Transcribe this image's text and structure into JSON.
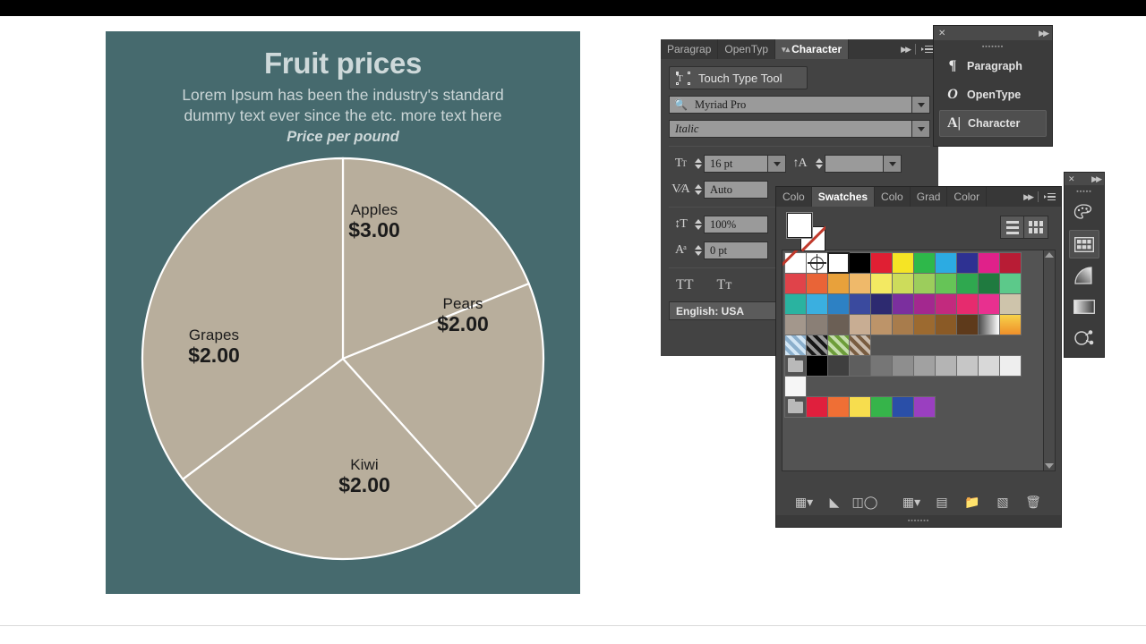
{
  "poster": {
    "title": "Fruit prices",
    "subtitle_line1": "Lorem Ipsum has been the industry's standard",
    "subtitle_line2": "dummy text ever since the etc. more text here",
    "note": "Price per pound",
    "background_color": "#466a6e",
    "slice_color": "#b8ae9c",
    "divider_color": "#ffffff"
  },
  "chart_data": {
    "type": "pie",
    "title": "Fruit prices",
    "subtitle": "Lorem Ipsum has been the industry's standard dummy text ever since the etc. more text here",
    "annotation": "Price per pound",
    "categories": [
      "Apples",
      "Pears",
      "Kiwi",
      "Grapes"
    ],
    "values": [
      3.0,
      2.0,
      2.0,
      2.0
    ],
    "value_labels": [
      "$3.00",
      "$2.00",
      "$2.00",
      "$2.00"
    ],
    "unit": "USD per pound",
    "slice_fill": "#b8ae9c",
    "legend": "none",
    "labels_inside": true,
    "slices": [
      {
        "name": "Apples",
        "value_label": "$3.00",
        "start_deg": 0,
        "end_deg": 68
      },
      {
        "name": "Pears",
        "value_label": "$2.00",
        "start_deg": 68,
        "end_deg": 138
      },
      {
        "name": "Kiwi",
        "value_label": "$2.00",
        "start_deg": 138,
        "end_deg": 233
      },
      {
        "name": "Grapes",
        "value_label": "$2.00",
        "start_deg": 233,
        "end_deg": 360
      }
    ]
  },
  "character_panel": {
    "tabs": [
      {
        "label": "Paragrap",
        "active": false
      },
      {
        "label": "OpenTyp",
        "active": false
      },
      {
        "label": "Character",
        "active": true
      }
    ],
    "touch_type_tool": "Touch Type Tool",
    "font_family": "Myriad Pro",
    "font_style": "Italic",
    "font_size": "16 pt",
    "leading": "",
    "kerning": "Auto",
    "vertical_scale": "100%",
    "baseline_shift": "0 pt",
    "all_caps": "TT",
    "small_caps": "Tт",
    "language": "English: USA"
  },
  "mini_dock": {
    "items": [
      {
        "icon": "¶",
        "label": "Paragraph",
        "selected": false
      },
      {
        "icon": "O",
        "label": "OpenType",
        "selected": false
      },
      {
        "icon": "A|",
        "label": "Character",
        "selected": true
      }
    ]
  },
  "swatches_panel": {
    "tabs": [
      {
        "label": "Colo",
        "active": false
      },
      {
        "label": "Swatches",
        "active": true
      },
      {
        "label": "Colo",
        "active": false
      },
      {
        "label": "Grad",
        "active": false
      },
      {
        "label": "Color",
        "active": false
      }
    ],
    "fill_color": "#ffffff",
    "stroke_color": "none",
    "rows": [
      {
        "kind": "colors",
        "cells": [
          {
            "type": "none"
          },
          {
            "type": "registration"
          },
          {
            "type": "color",
            "hex": "#ffffff",
            "selected": true
          },
          {
            "type": "color",
            "hex": "#000000"
          },
          {
            "type": "color",
            "hex": "#e01f33"
          },
          {
            "type": "color",
            "hex": "#f5e425"
          },
          {
            "type": "color",
            "hex": "#2eb84a"
          },
          {
            "type": "color",
            "hex": "#2cabe2"
          },
          {
            "type": "color",
            "hex": "#2e3192"
          },
          {
            "type": "color",
            "hex": "#e0218a"
          },
          {
            "type": "color",
            "hex": "#b81c35"
          }
        ]
      },
      {
        "kind": "colors",
        "cells": [
          {
            "type": "color",
            "hex": "#e0434a"
          },
          {
            "type": "color",
            "hex": "#e96437"
          },
          {
            "type": "color",
            "hex": "#e8a13b"
          },
          {
            "type": "color",
            "hex": "#efb96a"
          },
          {
            "type": "color",
            "hex": "#f3e962"
          },
          {
            "type": "color",
            "hex": "#cddc5b"
          },
          {
            "type": "color",
            "hex": "#9ccd5c"
          },
          {
            "type": "color",
            "hex": "#66c457"
          },
          {
            "type": "color",
            "hex": "#2fa84f"
          },
          {
            "type": "color",
            "hex": "#1f7a3f"
          },
          {
            "type": "color",
            "hex": "#5cc98a"
          }
        ]
      },
      {
        "kind": "colors",
        "cells": [
          {
            "type": "color",
            "hex": "#2ab3a0"
          },
          {
            "type": "color",
            "hex": "#3aafe0"
          },
          {
            "type": "color",
            "hex": "#2d81c4"
          },
          {
            "type": "color",
            "hex": "#3a4a9e"
          },
          {
            "type": "color",
            "hex": "#2d2a70"
          },
          {
            "type": "color",
            "hex": "#7b2f9e"
          },
          {
            "type": "color",
            "hex": "#a3288f"
          },
          {
            "type": "color",
            "hex": "#c22a7e"
          },
          {
            "type": "color",
            "hex": "#e62b6e"
          },
          {
            "type": "color",
            "hex": "#e8308f"
          },
          {
            "type": "color",
            "hex": "#cec4ab"
          }
        ]
      },
      {
        "kind": "colors",
        "cells": [
          {
            "type": "color",
            "hex": "#a3978c"
          },
          {
            "type": "color",
            "hex": "#8a7f76"
          },
          {
            "type": "color",
            "hex": "#6b5f55"
          },
          {
            "type": "color",
            "hex": "#c8ad93"
          },
          {
            "type": "color",
            "hex": "#bd9469"
          },
          {
            "type": "color",
            "hex": "#a87c4c"
          },
          {
            "type": "color",
            "hex": "#9c6a30"
          },
          {
            "type": "color",
            "hex": "#8a5a26"
          },
          {
            "type": "color",
            "hex": "#5e3a1b"
          },
          {
            "type": "gradient",
            "hex": "#ffffff"
          },
          {
            "type": "gradient2",
            "hex": "#f5a623"
          }
        ]
      },
      {
        "kind": "patterns",
        "cells": [
          {
            "type": "pattern",
            "hex": "#9ec7e8"
          },
          {
            "type": "pattern",
            "hex": "#1a1a1a"
          },
          {
            "type": "pattern",
            "hex": "#7cb342"
          },
          {
            "type": "pattern",
            "hex": "#8a6a4a"
          }
        ]
      },
      {
        "kind": "grays",
        "cells": [
          {
            "type": "folder"
          },
          {
            "type": "color",
            "hex": "#000000"
          },
          {
            "type": "color",
            "hex": "#3f3f3f"
          },
          {
            "type": "color",
            "hex": "#5e5e5e"
          },
          {
            "type": "color",
            "hex": "#767676"
          },
          {
            "type": "color",
            "hex": "#8e8e8e"
          },
          {
            "type": "color",
            "hex": "#a1a1a1"
          },
          {
            "type": "color",
            "hex": "#b4b4b4"
          },
          {
            "type": "color",
            "hex": "#c6c6c6"
          },
          {
            "type": "color",
            "hex": "#d8d8d8"
          },
          {
            "type": "color",
            "hex": "#eeeeee"
          }
        ]
      },
      {
        "kind": "grays2",
        "cells": [
          {
            "type": "color",
            "hex": "#f6f6f6"
          }
        ]
      },
      {
        "kind": "brights",
        "cells": [
          {
            "type": "folder"
          },
          {
            "type": "color",
            "hex": "#e01f3d"
          },
          {
            "type": "color",
            "hex": "#ef6f35"
          },
          {
            "type": "color",
            "hex": "#f7dd4e"
          },
          {
            "type": "color",
            "hex": "#36b44a"
          },
          {
            "type": "color",
            "hex": "#2a4fa8"
          },
          {
            "type": "color",
            "hex": "#9a3fc0"
          }
        ]
      }
    ],
    "footer_icons": [
      "swatch-libraries-icon",
      "show-swatch-kinds-icon",
      "link-color-group-icon",
      "new-color-group-icon",
      "swatch-options-icon",
      "folder-icon",
      "new-swatch-icon",
      "delete-swatch-icon"
    ]
  },
  "icon_dock": {
    "items": [
      {
        "name": "color-panel-icon",
        "selected": false
      },
      {
        "name": "swatches-panel-icon",
        "selected": true
      },
      {
        "name": "gradient-panel-icon",
        "selected": false
      },
      {
        "name": "stroke-panel-icon",
        "selected": false
      },
      {
        "name": "symbols-panel-icon",
        "selected": false
      }
    ]
  }
}
